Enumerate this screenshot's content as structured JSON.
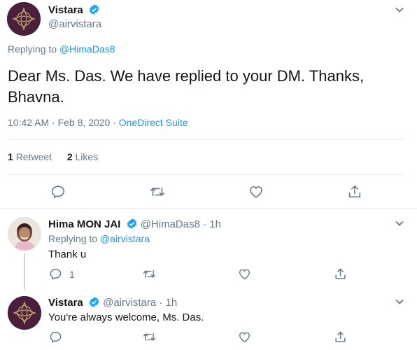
{
  "main_tweet": {
    "name": "Vistara",
    "handle": "@airvistara",
    "replying_label": "Replying to",
    "replying_handle": "@HimaDas8",
    "text": "Dear Ms. Das. We have replied to your DM. Thanks, Bhavna.",
    "time": "10:42 AM",
    "date": "Feb 8, 2020",
    "source": "OneDirect Suite",
    "retweets_count": "1",
    "retweets_label": "Retweet",
    "likes_count": "2",
    "likes_label": "Likes"
  },
  "reply_1": {
    "name": "Hima MON JAI",
    "handle": "@HimaDas8",
    "age": "1h",
    "replying_label": "Replying to",
    "replying_handle": "@airvistara",
    "text": "Thank u",
    "reply_count": "1"
  },
  "reply_2": {
    "name": "Vistara",
    "handle": "@airvistara",
    "age": "1h",
    "text": "You're always welcome, Ms. Das."
  },
  "colors": {
    "accent": "#1b95e0",
    "verified": "#1da1f2",
    "brand_avatar": "#4a1e3d",
    "muted": "#657786"
  }
}
